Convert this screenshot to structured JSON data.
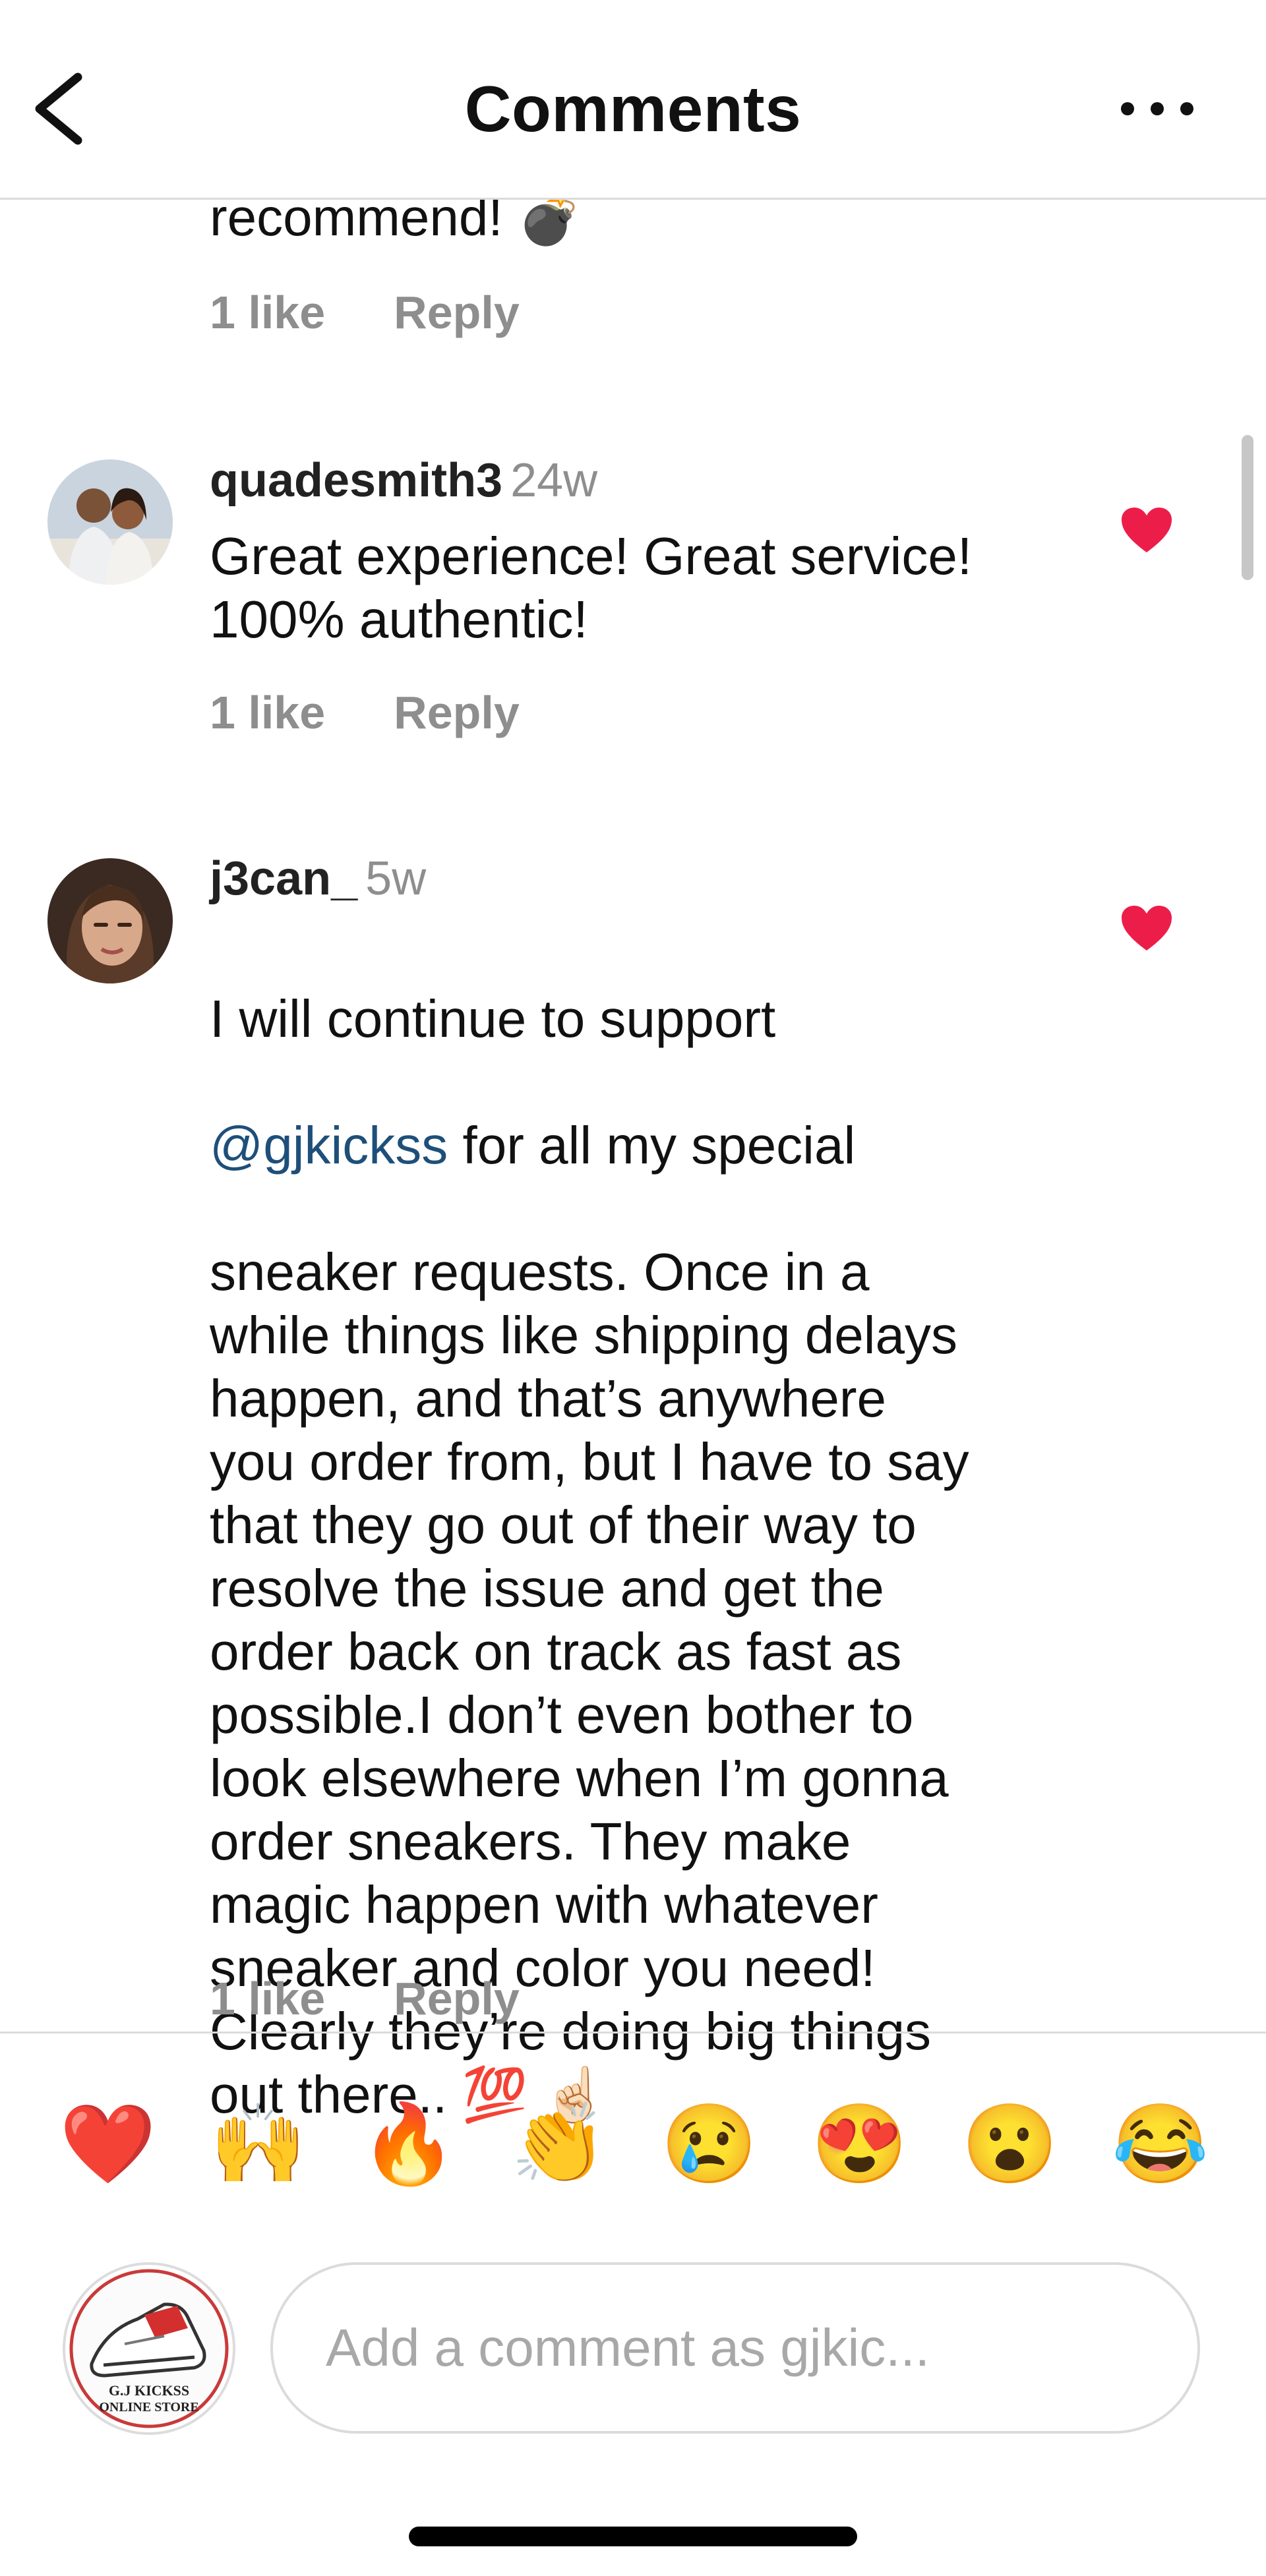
{
  "header": {
    "title": "Comments"
  },
  "comments": [
    {
      "partial_text": "recommend! 💣",
      "likes_label": "1 like",
      "reply_label": "Reply"
    },
    {
      "username": "quadesmith3",
      "timestamp": "24w",
      "text": "Great experience! Great service!\n100% authentic!",
      "likes_label": "1 like",
      "reply_label": "Reply",
      "liked": true
    },
    {
      "username": "j3can_",
      "timestamp": "5w",
      "text_line1": "I will continue to support",
      "mention": "@gjkickss",
      "text_after_mention": " for all my special",
      "text_rest": "sneaker requests. Once in a\nwhile things like shipping delays\nhappen, and that’s anywhere\nyou order from, but I have to say\nthat they go out of their way to\nresolve the issue and get the\norder back on track as fast as\npossible.I don’t even bother to\nlook elsewhere when I’m gonna\norder sneakers. They make\nmagic happen with whatever\nsneaker and color you need!\nClearly they’re doing big things\nout there.. 💯 ☝🏻",
      "likes_label": "1 like",
      "reply_label": "Reply",
      "liked": true
    }
  ],
  "emoji_bar": [
    "❤️",
    "🙌",
    "🔥",
    "👏",
    "😢",
    "😍",
    "😮",
    "😂"
  ],
  "composer": {
    "placeholder": "Add a comment as gjkic...",
    "avatar_text_line1": "G.J KICKSS",
    "avatar_text_line2": "ONLINE STORE"
  },
  "colors": {
    "heart": "#ed1d49",
    "mention": "#1e4f7a",
    "meta_gray": "#8e8e8e",
    "divider": "#dbdbdb"
  }
}
